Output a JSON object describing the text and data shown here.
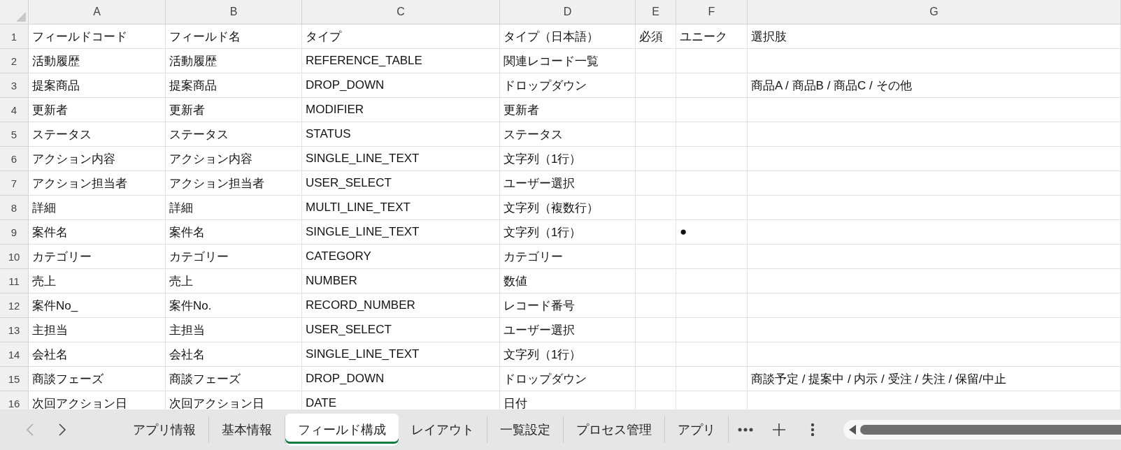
{
  "columns": [
    "A",
    "B",
    "C",
    "D",
    "E",
    "F",
    "G"
  ],
  "rows": [
    {
      "number": "1",
      "cells": {
        "A": "フィールドコード",
        "B": "フィールド名",
        "C": "タイプ",
        "D": "タイプ（日本語）",
        "E": "必須",
        "F": "ユニーク",
        "G": "選択肢"
      }
    },
    {
      "number": "2",
      "cells": {
        "A": "活動履歴",
        "B": "活動履歴",
        "C": "REFERENCE_TABLE",
        "D": "関連レコード一覧"
      }
    },
    {
      "number": "3",
      "cells": {
        "A": "提案商品",
        "B": "提案商品",
        "C": "DROP_DOWN",
        "D": "ドロップダウン",
        "G": "商品A / 商品B / 商品C / その他"
      }
    },
    {
      "number": "4",
      "cells": {
        "A": "更新者",
        "B": "更新者",
        "C": "MODIFIER",
        "D": "更新者"
      }
    },
    {
      "number": "5",
      "cells": {
        "A": "ステータス",
        "B": "ステータス",
        "C": "STATUS",
        "D": "ステータス"
      }
    },
    {
      "number": "6",
      "cells": {
        "A": "アクション内容",
        "B": "アクション内容",
        "C": "SINGLE_LINE_TEXT",
        "D": "文字列（1行）"
      }
    },
    {
      "number": "7",
      "cells": {
        "A": "アクション担当者",
        "B": "アクション担当者",
        "C": "USER_SELECT",
        "D": "ユーザー選択"
      }
    },
    {
      "number": "8",
      "cells": {
        "A": "詳細",
        "B": "詳細",
        "C": "MULTI_LINE_TEXT",
        "D": "文字列（複数行）"
      }
    },
    {
      "number": "9",
      "cells": {
        "A": "案件名",
        "B": "案件名",
        "C": "SINGLE_LINE_TEXT",
        "D": "文字列（1行）",
        "F": "●"
      }
    },
    {
      "number": "10",
      "cells": {
        "A": "カテゴリー",
        "B": "カテゴリー",
        "C": "CATEGORY",
        "D": "カテゴリー"
      }
    },
    {
      "number": "11",
      "cells": {
        "A": "売上",
        "B": "売上",
        "C": "NUMBER",
        "D": "数値"
      }
    },
    {
      "number": "12",
      "cells": {
        "A": "案件No_",
        "B": "案件No.",
        "C": "RECORD_NUMBER",
        "D": "レコード番号"
      }
    },
    {
      "number": "13",
      "cells": {
        "A": "主担当",
        "B": "主担当",
        "C": "USER_SELECT",
        "D": "ユーザー選択"
      }
    },
    {
      "number": "14",
      "cells": {
        "A": "会社名",
        "B": "会社名",
        "C": "SINGLE_LINE_TEXT",
        "D": "文字列（1行）"
      }
    },
    {
      "number": "15",
      "cells": {
        "A": "商談フェーズ",
        "B": "商談フェーズ",
        "C": "DROP_DOWN",
        "D": "ドロップダウン",
        "G": "商談予定 / 提案中 / 内示 / 受注 / 失注 / 保留/中止"
      }
    },
    {
      "number": "16",
      "cells": {
        "A": "次回アクション日",
        "B": "次回アクション日",
        "C": "DATE",
        "D": "日付"
      }
    }
  ],
  "sheet_tabs": [
    {
      "label": "アプリ情報",
      "selected": false
    },
    {
      "label": "基本情報",
      "selected": false
    },
    {
      "label": "フィールド構成",
      "selected": true
    },
    {
      "label": "レイアウト",
      "selected": false
    },
    {
      "label": "一覧設定",
      "selected": false
    },
    {
      "label": "プロセス管理",
      "selected": false
    },
    {
      "label": "アプリ",
      "selected": false
    }
  ]
}
